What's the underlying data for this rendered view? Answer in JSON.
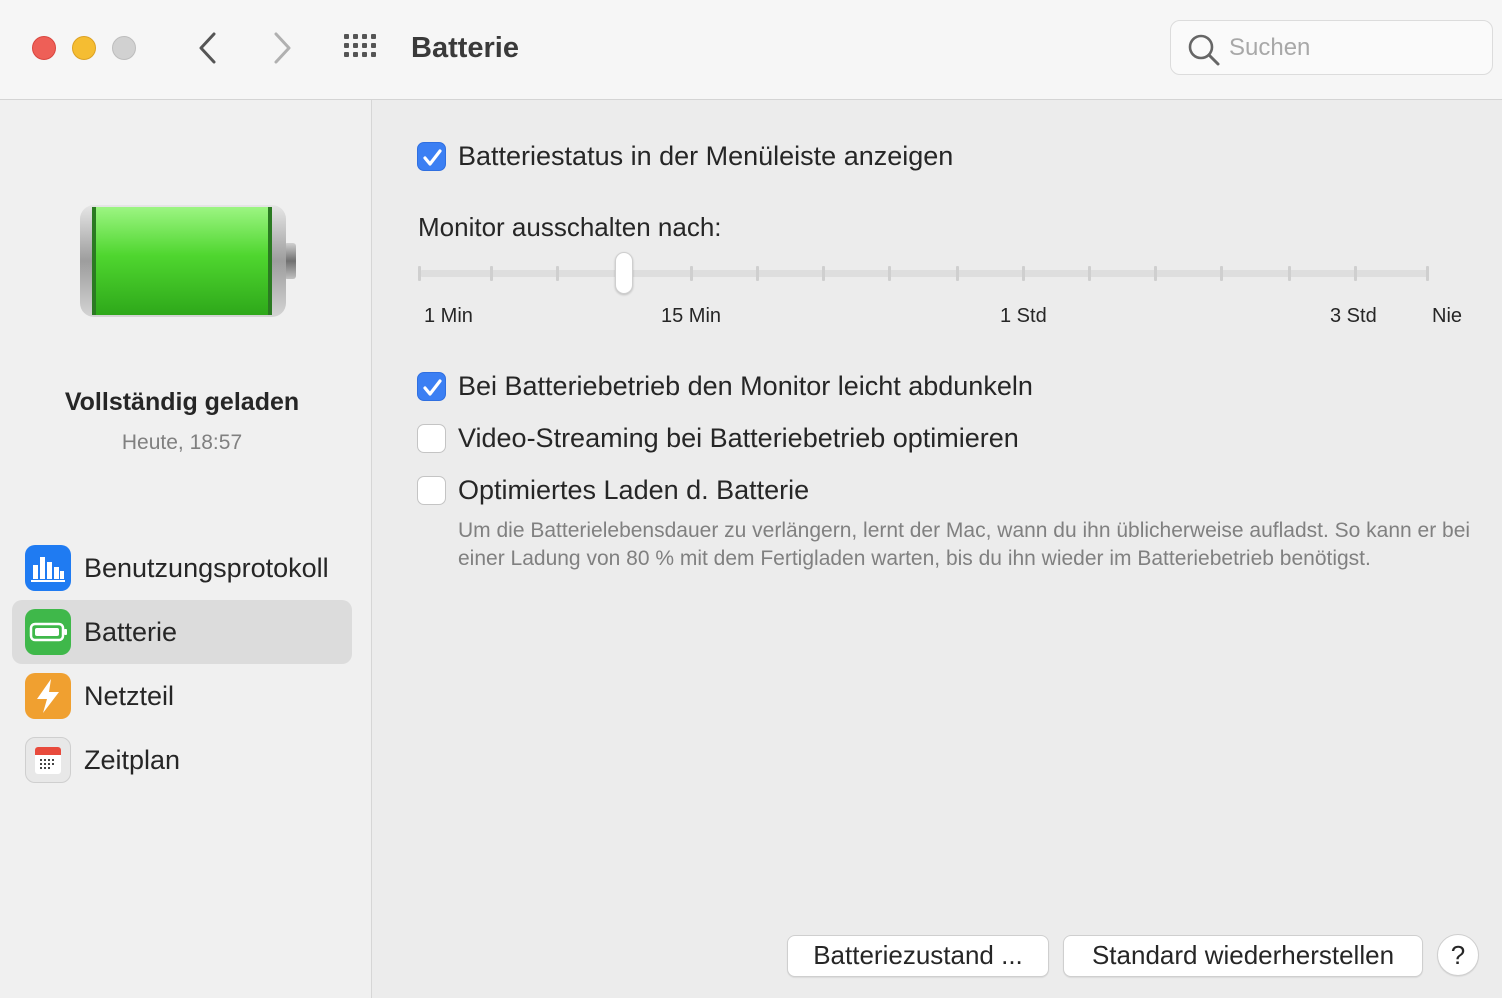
{
  "window": {
    "title": "Batterie",
    "search_placeholder": "Suchen"
  },
  "icons": {
    "back": "chevron-left-icon",
    "forward": "chevron-right-icon",
    "grid": "show-all-grid-icon",
    "search": "search-icon"
  },
  "sidebar": {
    "battery_level": 1.0,
    "status_title": "Vollständig geladen",
    "status_time": "Heute, 18:57",
    "items": [
      {
        "label": "Benutzungsprotokoll",
        "icon": "usage-chart-icon",
        "color": "#1f7bf2",
        "selected": false
      },
      {
        "label": "Batterie",
        "icon": "battery-icon",
        "color": "#3fb84a",
        "selected": true
      },
      {
        "label": "Netzteil",
        "icon": "lightning-bolt-icon",
        "color": "#f0a030",
        "selected": false
      },
      {
        "label": "Zeitplan",
        "icon": "calendar-icon",
        "color": "#e8e8e8",
        "selected": false
      }
    ]
  },
  "main": {
    "show_status_menubar": {
      "label": "Batteriestatus in der Menüleiste anzeigen",
      "checked": true
    },
    "monitor_off": {
      "label": "Monitor ausschalten nach:",
      "tick_labels": [
        "1 Min",
        "15 Min",
        "1 Std",
        "3 Std",
        "Nie"
      ],
      "selected_position": "between 1 Min and 15 Min (4th tick)"
    },
    "dim_display": {
      "label": "Bei Batteriebetrieb den Monitor leicht abdunkeln",
      "checked": true
    },
    "optimize_streaming": {
      "label": "Video-Streaming bei Batteriebetrieb optimieren",
      "checked": false
    },
    "optimized_charging": {
      "label": "Optimiertes Laden d. Batterie",
      "checked": false,
      "description": "Um die Batterielebensdauer zu verlängern, lernt der Mac, wann du ihn üblicherweise aufladst. So kann er bei einer Ladung von 80 % mit dem Fertigladen warten, bis du ihn wieder im Batteriebetrieb benötigst."
    }
  },
  "footer": {
    "battery_health_button": "Batteriezustand ...",
    "restore_defaults_button": "Standard wiederherstellen",
    "help_button": "?"
  },
  "colors": {
    "accent": "#3b7ff3",
    "battery_fill": "#4fd62f",
    "close": "#ee5f57",
    "minimize": "#f5bd32",
    "zoom": "#d1d1d1"
  }
}
